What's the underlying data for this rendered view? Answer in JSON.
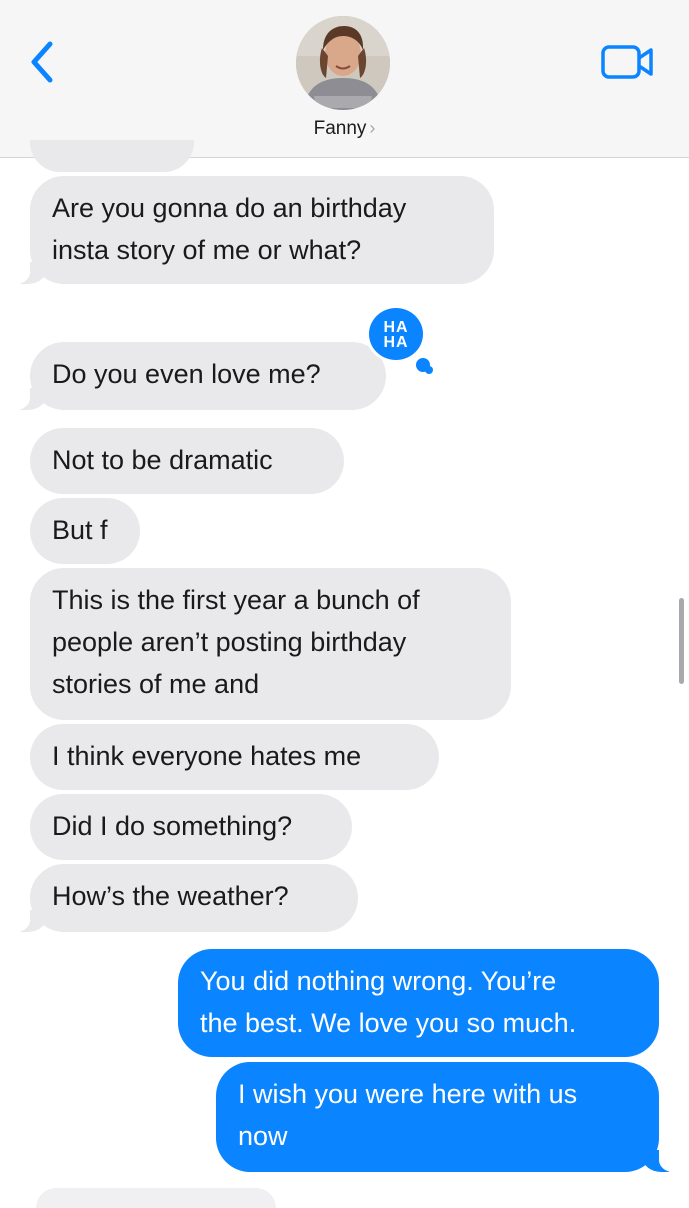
{
  "header": {
    "contact_name": "Fanny",
    "contact_chevron": "›",
    "back_icon": "chevron-left-icon",
    "video_icon": "video-camera-icon",
    "accent_color": "#0a84ff"
  },
  "tapback": {
    "label_line1": "HA",
    "label_line2": "HA"
  },
  "messages": [
    {
      "direction": "incoming",
      "line1": "Are you gonna do an birthday",
      "line2": "insta story of me or what?"
    },
    {
      "direction": "incoming",
      "text": "Do you even love me?"
    },
    {
      "direction": "incoming",
      "text": "Not to be dramatic"
    },
    {
      "direction": "incoming",
      "text": "But f"
    },
    {
      "direction": "incoming",
      "line1": "This is the first year a bunch of",
      "line2": "people aren’t posting birthday",
      "line3": "stories of me and"
    },
    {
      "direction": "incoming",
      "text": "I think everyone hates me"
    },
    {
      "direction": "incoming",
      "text": "Did I do something?"
    },
    {
      "direction": "incoming",
      "text": "How’s the weather?"
    },
    {
      "direction": "outgoing",
      "line1": "You did nothing wrong. You’re",
      "line2": "the best. We love you so much."
    },
    {
      "direction": "outgoing",
      "line1": "I wish you were here with us",
      "line2": "now"
    }
  ]
}
